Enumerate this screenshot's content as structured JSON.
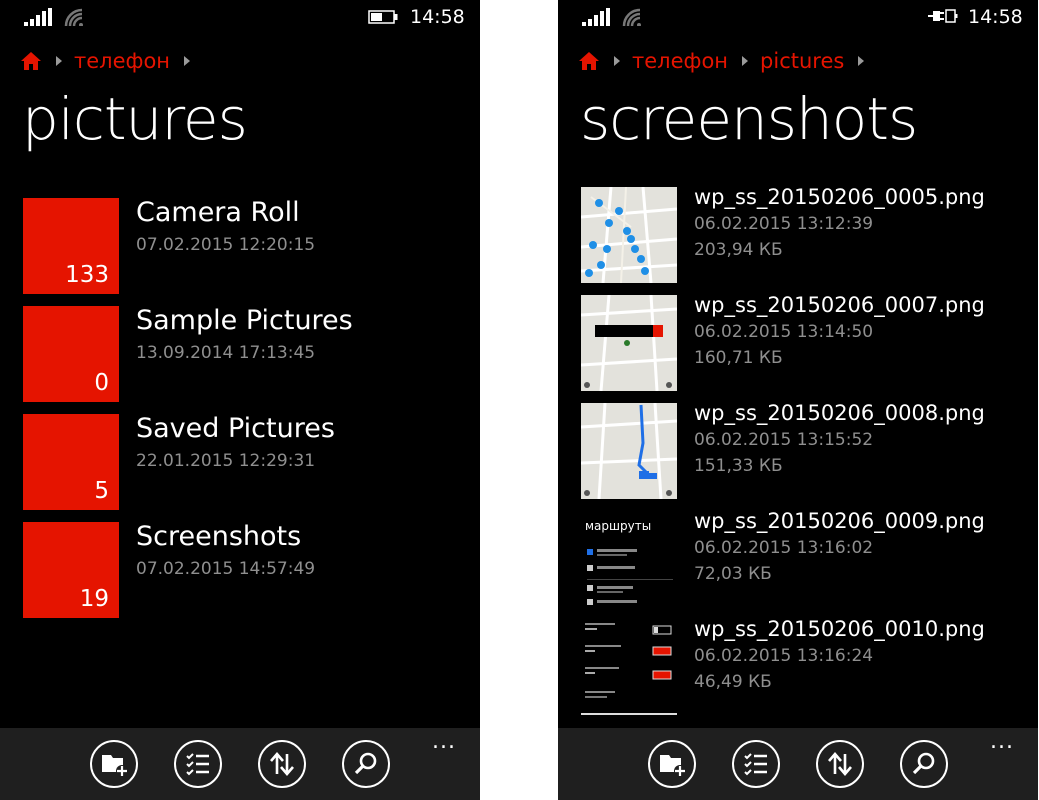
{
  "left_screen": {
    "status": {
      "time": "14:58",
      "battery": "battery-icon"
    },
    "breadcrumb": [
      "телефон"
    ],
    "title": "pictures",
    "folders": [
      {
        "name": "Camera Roll",
        "date": "07.02.2015 12:20:15",
        "count": "133"
      },
      {
        "name": "Sample Pictures",
        "date": "13.09.2014 17:13:45",
        "count": "0"
      },
      {
        "name": "Saved Pictures",
        "date": "22.01.2015 12:29:31",
        "count": "5"
      },
      {
        "name": "Screenshots",
        "date": "07.02.2015 14:57:49",
        "count": "19"
      }
    ],
    "app_bar": {
      "buttons": [
        "new-folder-icon",
        "select-icon",
        "sort-icon",
        "search-icon"
      ],
      "more": "..."
    }
  },
  "right_screen": {
    "status": {
      "time": "14:58",
      "battery": "battery-charging-icon"
    },
    "breadcrumb": [
      "телефон",
      "pictures"
    ],
    "title": "screenshots",
    "files": [
      {
        "name": "wp_ss_20150206_0005.png",
        "date": "06.02.2015 13:12:39",
        "size": "203,94 КБ",
        "thumb": "map-pins"
      },
      {
        "name": "wp_ss_20150206_0007.png",
        "date": "06.02.2015 13:14:50",
        "size": "160,71 КБ",
        "thumb": "map-popup"
      },
      {
        "name": "wp_ss_20150206_0008.png",
        "date": "06.02.2015 13:15:52",
        "size": "151,33 КБ",
        "thumb": "map-route"
      },
      {
        "name": "wp_ss_20150206_0009.png",
        "date": "06.02.2015 13:16:02",
        "size": "72,03 КБ",
        "thumb": "routes-menu"
      },
      {
        "name": "wp_ss_20150206_0010.png",
        "date": "06.02.2015 13:16:24",
        "size": "46,49 КБ",
        "thumb": "settings"
      }
    ],
    "thumb_texts": {
      "routes_title": "маршруты"
    },
    "app_bar": {
      "buttons": [
        "new-folder-icon",
        "select-icon",
        "sort-icon",
        "search-icon"
      ],
      "more": "..."
    }
  },
  "colors": {
    "accent": "#e51400",
    "background": "#000000",
    "app_bar": "#1f1f1f",
    "secondary_text": "#8f8f8f"
  }
}
